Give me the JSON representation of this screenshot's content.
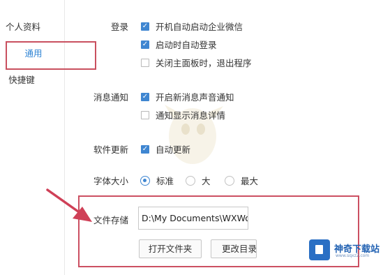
{
  "sidebar": {
    "items": [
      {
        "label": "个人资料",
        "active": false
      },
      {
        "label": "通用",
        "active": true
      },
      {
        "label": "快捷键",
        "active": false
      }
    ]
  },
  "settings": {
    "login": {
      "label": "登录",
      "options": [
        {
          "label": "开机自动启动企业微信",
          "checked": true
        },
        {
          "label": "启动时自动登录",
          "checked": true
        },
        {
          "label": "关闭主面板时，退出程序",
          "checked": false
        }
      ]
    },
    "notify": {
      "label": "消息通知",
      "options": [
        {
          "label": "开启新消息声音通知",
          "checked": true
        },
        {
          "label": "通知显示消息详情",
          "checked": false
        }
      ]
    },
    "update": {
      "label": "软件更新",
      "options": [
        {
          "label": "自动更新",
          "checked": true
        }
      ]
    },
    "font_size": {
      "label": "字体大小",
      "options": [
        {
          "label": "标准",
          "selected": true
        },
        {
          "label": "大",
          "selected": false
        },
        {
          "label": "最大",
          "selected": false
        }
      ]
    },
    "storage": {
      "label": "文件存储",
      "path": "D:\\My Documents\\WXWork",
      "open_folder_label": "打开文件夹",
      "change_dir_label": "更改目录"
    }
  },
  "watermark": {
    "title": "神奇下载站",
    "subtitle": "www.sqxz2.com",
    "icon": "site-logo-icon"
  },
  "colors": {
    "accent": "#3f86d1",
    "active_nav": "#2f84d4",
    "highlight_box": "#c9505f"
  }
}
